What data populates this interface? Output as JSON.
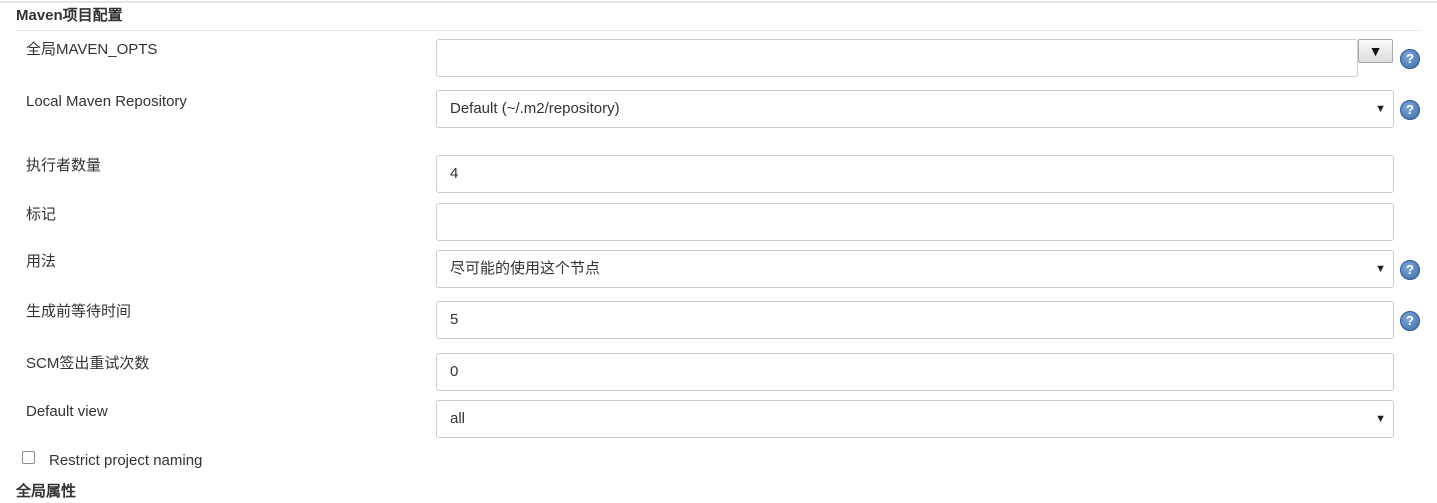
{
  "maven_section": {
    "title": "Maven项目配置"
  },
  "rows": {
    "maven_opts": {
      "label": "全局MAVEN_OPTS",
      "value": "",
      "expand_glyph": "▼"
    },
    "local_repo": {
      "label": "Local Maven Repository",
      "value": "Default (~/.m2/repository)"
    },
    "executors": {
      "label": "执行者数量",
      "value": "4"
    },
    "labels": {
      "label": "标记",
      "value": ""
    },
    "usage": {
      "label": "用法",
      "value": "尽可能的使用这个节点"
    },
    "quiet_period": {
      "label": "生成前等待时间",
      "value": "5"
    },
    "scm_retry": {
      "label": "SCM签出重试次数",
      "value": "0"
    },
    "default_view": {
      "label": "Default view",
      "value": "all"
    }
  },
  "restrict_naming": {
    "label": "Restrict project naming",
    "checked": false
  },
  "global_properties": {
    "title": "全局属性"
  },
  "help_glyph": "?",
  "select_arrow_glyph": "▼"
}
